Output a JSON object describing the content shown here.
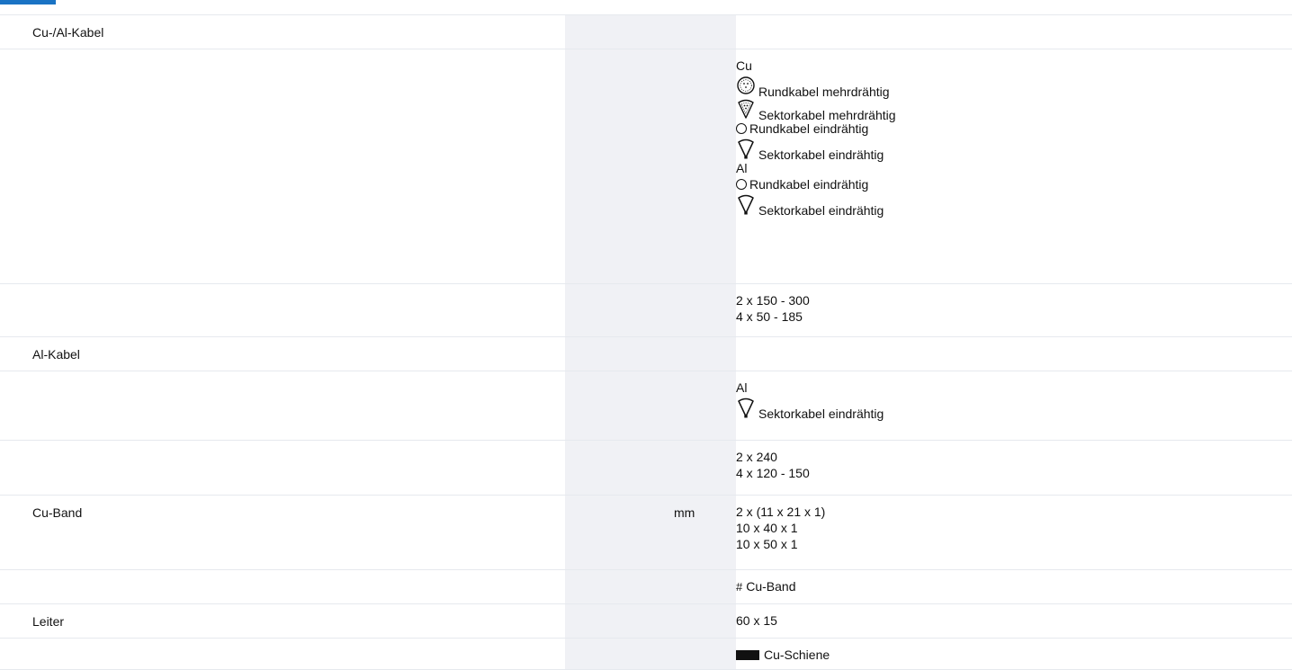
{
  "rows": [
    {
      "label": "Cu-/Al-Kabel",
      "unit": "",
      "lines": []
    },
    {
      "label": "",
      "unit": "",
      "lines": [
        {
          "text": "Cu"
        },
        {
          "icon": "round-stranded-cable-icon",
          "text": "Rundkabel mehrdrähtig"
        },
        {
          "icon": "sector-stranded-cable-icon",
          "text": "Sektorkabel mehrdrähtig"
        },
        {
          "glyph": "circle",
          "text": "Rundkabel eindrähtig"
        },
        {
          "icon": "sector-solid-cable-icon",
          "text": "Sektorkabel eindrähtig"
        },
        {
          "text": "Al"
        },
        {
          "glyph": "circle",
          "text": "Rundkabel eindrähtig"
        },
        {
          "icon": "sector-solid-cable-icon",
          "text": "Sektorkabel eindrähtig"
        }
      ]
    },
    {
      "label": "",
      "unit": "",
      "lines": [
        {
          "text": "2 x 150 - 300"
        },
        {
          "text": "4 x 50 - 185"
        }
      ]
    },
    {
      "label": "Al-Kabel",
      "unit": "",
      "lines": []
    },
    {
      "label": "",
      "unit": "",
      "lines": [
        {
          "text": "Al"
        },
        {
          "icon": "sector-solid-cable-icon",
          "text": "Sektorkabel eindrähtig"
        }
      ]
    },
    {
      "label": "",
      "unit": "",
      "lines": [
        {
          "text": "2 x 240"
        },
        {
          "text": "4 x 120 - 150"
        }
      ]
    },
    {
      "label": "Cu-Band",
      "unit": "mm",
      "lines": [
        {
          "text": "2 x (11 x 21 x 1)"
        },
        {
          "text": "10 x 40 x 1"
        },
        {
          "text": "10 x 50 x 1"
        }
      ]
    },
    {
      "label": "",
      "unit": "",
      "lines": [
        {
          "glyph": "hash",
          "text": "Cu-Band"
        }
      ]
    },
    {
      "label": "Leiter",
      "unit": "",
      "lines": [
        {
          "text": "60 x 15"
        }
      ]
    },
    {
      "label": "",
      "unit": "",
      "lines": [
        {
          "glyph": "rect",
          "text": "Cu-Schiene"
        }
      ]
    }
  ]
}
